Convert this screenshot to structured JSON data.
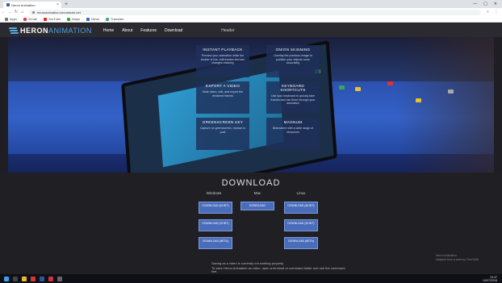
{
  "browser": {
    "tab_title": "Heron Animation",
    "new_tab": "+",
    "tab_close": "×",
    "url": "heronanimation.brunelweb.net",
    "window": {
      "minimize": "—",
      "maximize": "▢",
      "close": "✕"
    },
    "nav": {
      "back": "←",
      "forward": "→",
      "reload": "↻",
      "home": "⌂"
    },
    "bookmarks": [
      "Apps",
      "Gmail",
      "YouTube",
      "Maps",
      "News",
      "Translate"
    ]
  },
  "site": {
    "logo_part1": "HERON",
    "logo_part2": "ANIMATION",
    "nav": [
      "Home",
      "About",
      "Features",
      "Download"
    ],
    "nav_extra": "Header"
  },
  "features": [
    {
      "title": "INSTANT PLAYBACK",
      "desc": "Preview your animation while the shutter is live, edit frames and see changes instantly"
    },
    {
      "title": "ONION SKINNING",
      "desc": "Overlay the previous image to position your objects more accurately"
    },
    {
      "title": "EXPORT A VIDEO",
      "desc": "Mute video, edit, and export the rendered frames"
    },
    {
      "title": "KEYBOARD SHORTCUTS",
      "desc": "Use your keyboard to quickly take frames and use them through your animation"
    },
    {
      "title": "GREENSCREEN KEY",
      "desc": "Capture on greenscreen, replace in post"
    },
    {
      "title": "MAGNUM",
      "desc": "Brainstorm with a wide range of resources"
    }
  ],
  "download": {
    "title": "DOWNLOAD",
    "os": {
      "windows": "Windows",
      "mac": "Mac",
      "linux": "Linux"
    },
    "windows_buttons": [
      "DOWNLOAD (64 BIT)",
      "DOWNLOAD (32 BIT)",
      "DOWNLOAD (BETA)"
    ],
    "mac_buttons": [
      "DOWNLOAD"
    ],
    "linux_buttons": [
      "DOWNLOAD (64 BIT)",
      "DOWNLOAD (32 BIT)",
      "DOWNLOAD (BETA)"
    ],
    "note1": "Saving as a video is currently not working properly.",
    "note2": "To save Heron Animation as video, open a terminal or command folder and use the command line.",
    "corner1": "Heron Animation",
    "corner2": "Adapted from a work by Tom Ruth"
  },
  "taskbar": {
    "time": "10:47",
    "date": "14/07/2018"
  },
  "colors": {
    "accent": "#4da3e8",
    "button": "#4a6dbb",
    "nav_bg": "#2a2a30",
    "section_bg": "#1f1f24"
  }
}
